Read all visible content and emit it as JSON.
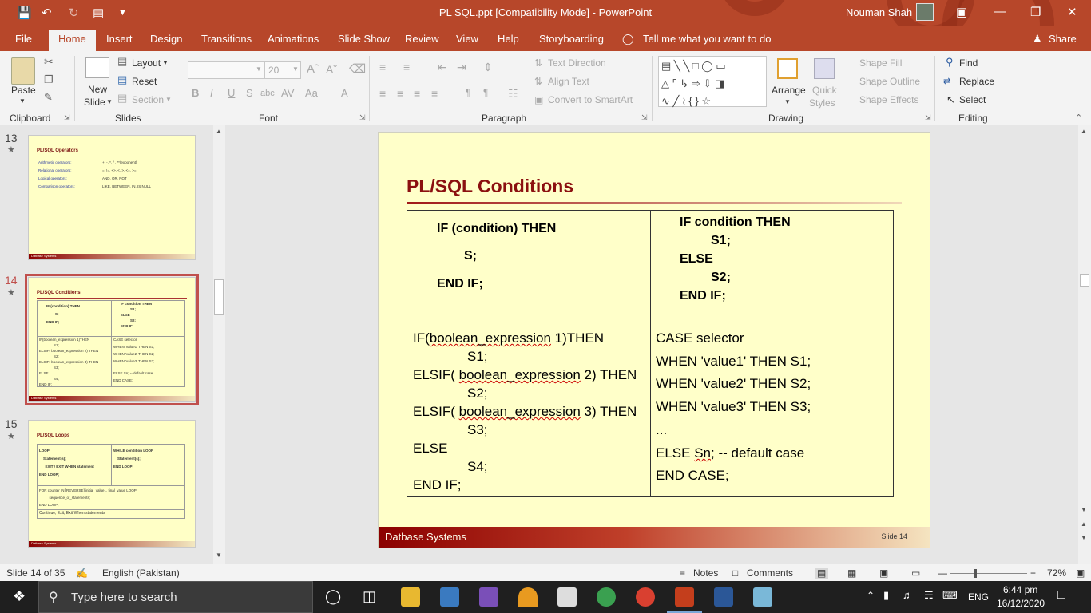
{
  "window": {
    "title": "PL SQL.ppt [Compatibility Mode]  -  PowerPoint",
    "user": "Nouman Shah"
  },
  "tabs": [
    "File",
    "Home",
    "Insert",
    "Design",
    "Transitions",
    "Animations",
    "Slide Show",
    "Review",
    "View",
    "Help",
    "Storyboarding"
  ],
  "tell_me": "Tell me what you want to do",
  "share": "Share",
  "ribbon": {
    "clipboard": {
      "paste": "Paste",
      "group": "Clipboard"
    },
    "slides": {
      "new_slide_1": "New",
      "new_slide_2": "Slide",
      "layout": "Layout",
      "reset": "Reset",
      "section": "Section",
      "group": "Slides"
    },
    "font": {
      "size": "20",
      "group": "Font"
    },
    "paragraph": {
      "text_direction": "Text Direction",
      "align_text": "Align Text",
      "convert": "Convert to SmartArt",
      "group": "Paragraph"
    },
    "drawing": {
      "arrange": "Arrange",
      "quick_1": "Quick",
      "quick_2": "Styles",
      "fill": "Shape Fill",
      "outline": "Shape Outline",
      "effects": "Shape Effects",
      "group": "Drawing"
    },
    "editing": {
      "find": "Find",
      "replace": "Replace",
      "select": "Select",
      "group": "Editing"
    }
  },
  "thumbnails": [
    {
      "number": "13",
      "title": "PL/SQL Operators",
      "rows": [
        {
          "label": "Arithmetic operators:",
          "value": "+, -, *, / , **(exponent)"
        },
        {
          "label": "Relational operators:",
          "value": "=, !=, <>, <, >, <=, >="
        },
        {
          "label": "Logical operators:",
          "value": "AND, OR, NOT"
        },
        {
          "label": "Comparison operators:",
          "value": "LIKE, BETWEEN, IN, IS NULL"
        }
      ],
      "footer": "Datbase Systems"
    },
    {
      "number": "14",
      "title": "PL/SQL Conditions",
      "footer": "Datbase Systems"
    },
    {
      "number": "15",
      "title": "PL/SQL Loops",
      "loop": "LOOP\n    Statement(s);\n      EXIT / EXIT WHEN statement\nEND LOOP;",
      "while": "WHILE condition LOOP\n    Statement(s);\nEND LOOP;",
      "for": "FOR counter IN [REVERSE] initial_value .. final_value LOOP\n          sequence_of_statements;\nEND LOOP;",
      "continue": "Continue, Exit, Exit When statements",
      "footer": "Datbase Systems"
    }
  ],
  "slide": {
    "title": "PL/SQL Conditions",
    "footer_left": "Datbase Systems",
    "footer_right": "Slide 14",
    "if_then": [
      "IF (condition) THEN",
      "S;",
      "END IF;"
    ],
    "if_else": [
      "IF condition THEN",
      "S1;",
      "ELSE",
      "S2;",
      "END IF;"
    ],
    "elsif": [
      "IF(",
      "boolean_expression",
      " 1)THEN",
      "S1;",
      "ELSIF( ",
      "boolean_expression",
      " 2) THEN",
      "S2;",
      "ELSIF( ",
      "boolean_expression",
      " 3) THEN",
      "S3;",
      "ELSE",
      "S4;",
      "END IF;"
    ],
    "case": [
      "CASE selector",
      "WHEN 'value1' THEN S1;",
      "WHEN 'value2' THEN S2;",
      "WHEN 'value3' THEN S3;",
      "...",
      "ELSE ",
      "Sn",
      "; -- default case",
      "END CASE;"
    ]
  },
  "status": {
    "slide_of": "Slide 14 of 35",
    "language": "English (Pakistan)",
    "notes": "Notes",
    "comments": "Comments",
    "zoom": "72%"
  },
  "taskbar": {
    "search": "Type here to search",
    "lang": "ENG",
    "time": "6:44 pm",
    "date": "16/12/2020"
  },
  "colors": {
    "accent": "#b7472a",
    "slide_bg": "#ffffc9",
    "title": "#8b1010"
  }
}
